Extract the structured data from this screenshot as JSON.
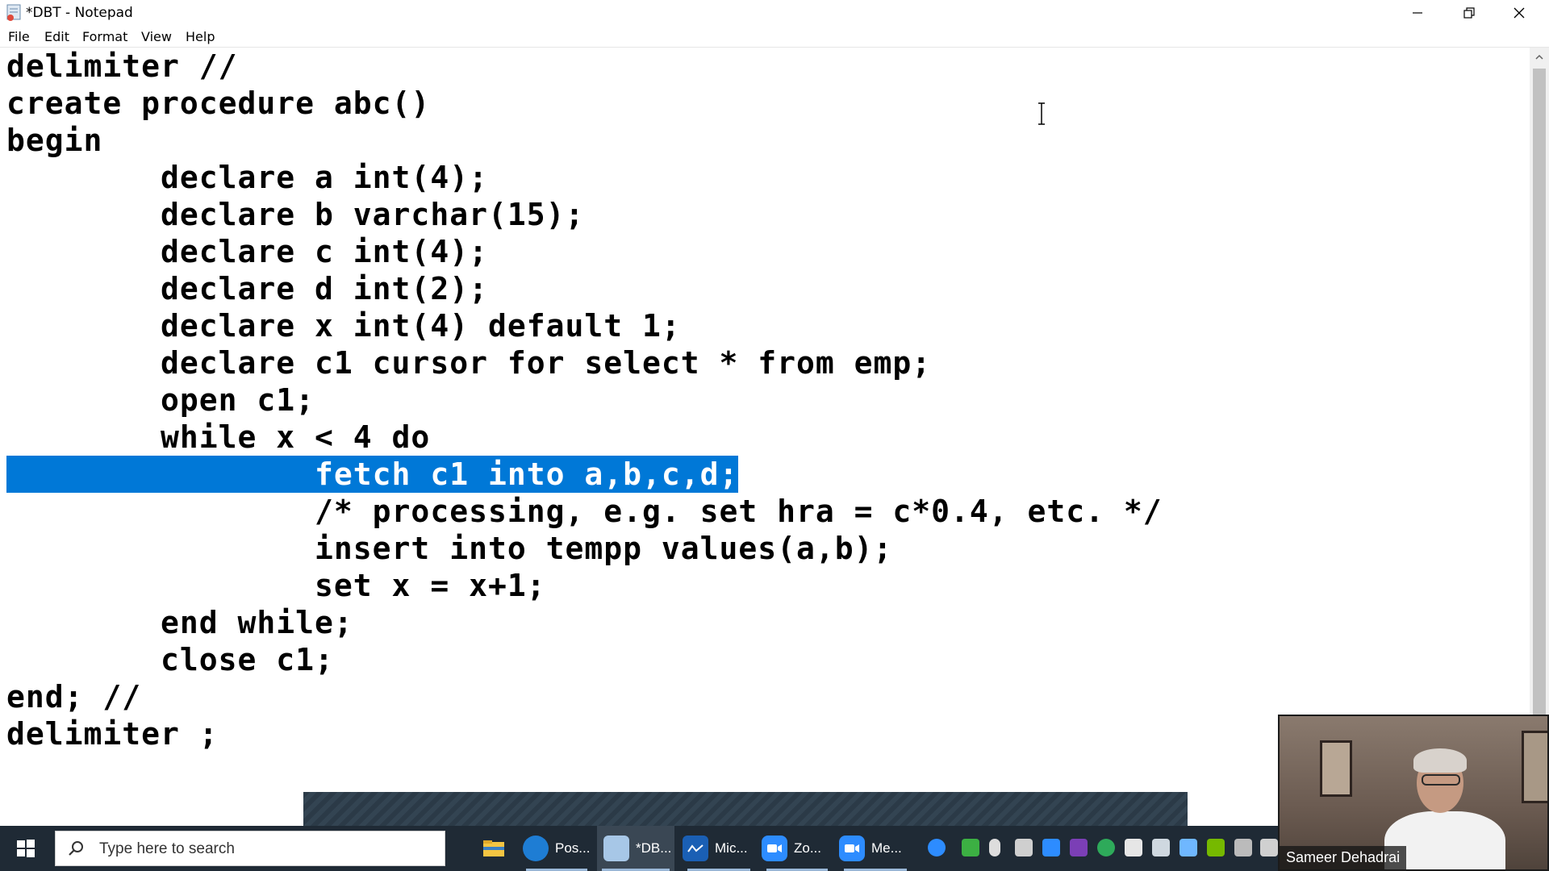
{
  "window": {
    "title": "*DBT - Notepad"
  },
  "menu": {
    "file": "File",
    "edit": "Edit",
    "format": "Format",
    "view": "View",
    "help": "Help"
  },
  "editor": {
    "lines": [
      "delimiter //",
      "create procedure abc()",
      "begin",
      "        declare a int(4);",
      "        declare b varchar(15);",
      "        declare c int(4);",
      "        declare d int(2);",
      "        declare x int(4) default 1;",
      "        declare c1 cursor for select * from emp;",
      "        open c1;",
      "        while x < 4 do",
      "                fetch c1 into a,b,c,d;",
      "                /* processing, e.g. set hra = c*0.4, etc. */",
      "                insert into tempp values(a,b);",
      "                set x = x+1;",
      "        end while;",
      "        close c1;",
      "end; //",
      "delimiter ;"
    ],
    "selected_line_index": 11
  },
  "taskbar": {
    "search_placeholder": "Type here to search",
    "apps": [
      {
        "label": "Pos...",
        "icon": "edge-icon"
      },
      {
        "label": "*DB...",
        "icon": "notepad-icon"
      },
      {
        "label": "Mic...",
        "icon": "whiteboard-icon"
      },
      {
        "label": "Zo...",
        "icon": "zoom-icon"
      },
      {
        "label": "Me...",
        "icon": "zoom-meeting-icon"
      }
    ]
  },
  "video": {
    "participant_name": "Sameer Dehadrai"
  },
  "colors": {
    "selection": "#0078d7",
    "taskbar": "#1f2a35"
  }
}
